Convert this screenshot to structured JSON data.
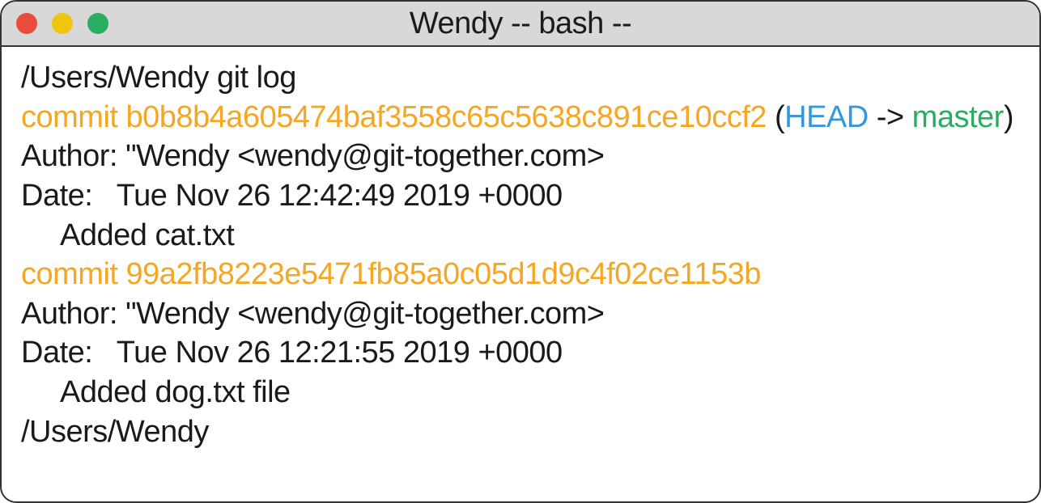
{
  "window": {
    "title": "Wendy -- bash --"
  },
  "colors": {
    "red": "#e74c3c",
    "yellow": "#f1c40f",
    "green": "#27ae60",
    "orange": "#f5a623",
    "blue": "#3498db",
    "greenText": "#27ae60"
  },
  "terminal": {
    "prompt1": "/Users/Wendy git log",
    "commit1": {
      "prefix": "commit ",
      "hash": "b0b8b4a605474baf3558c65c5638c891ce10ccf2",
      "refOpen": " (",
      "head": "HEAD",
      "arrow": " -> ",
      "branch": "master",
      "refClose": ")"
    },
    "author1": "Author: \"Wendy <wendy@git-together.com>",
    "date1": "Date:   Tue Nov 26 12:42:49 2019 +0000",
    "message1": "Added cat.txt",
    "commit2": {
      "prefix": "commit ",
      "hash": "99a2fb8223e5471fb85a0c05d1d9c4f02ce1153b"
    },
    "author2": "Author: \"Wendy <wendy@git-together.com>",
    "date2": "Date:   Tue Nov 26 12:21:55 2019 +0000",
    "message2": "Added dog.txt file",
    "prompt2": "/Users/Wendy"
  }
}
